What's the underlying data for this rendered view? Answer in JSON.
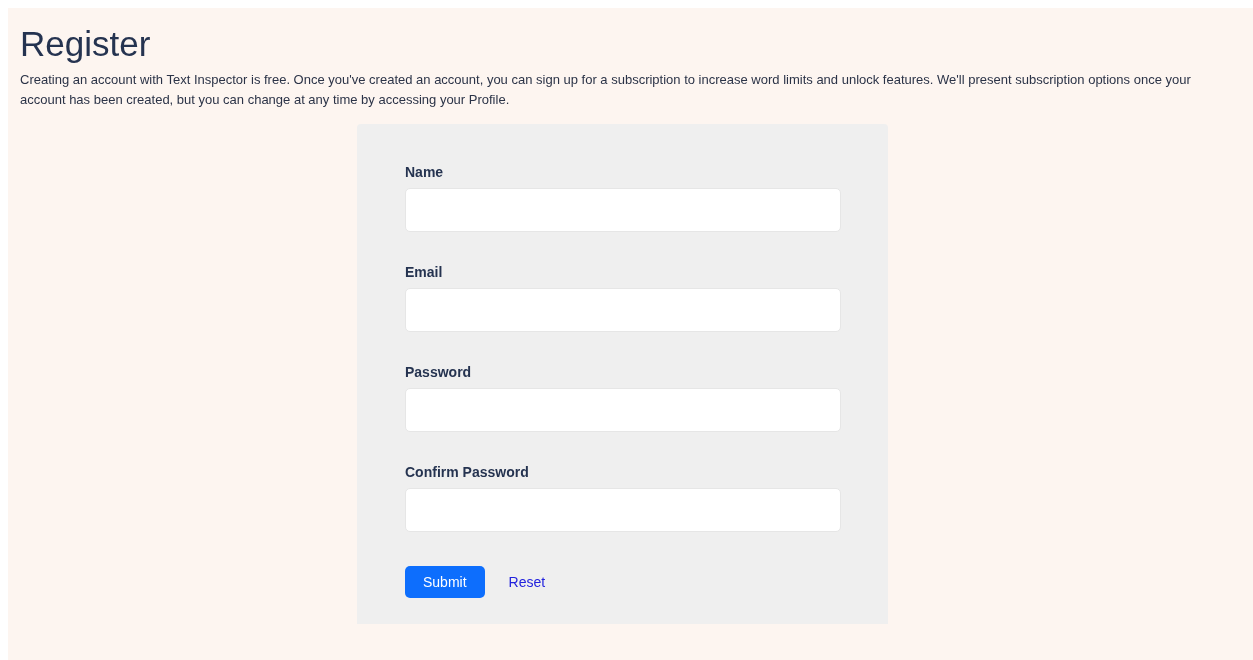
{
  "title": "Register",
  "intro": "Creating an account with Text Inspector is free. Once you've created an account, you can sign up for a subscription to increase word limits and unlock features. We'll present subscription options once your account has been created, but you can change at any time by accessing your Profile.",
  "fields": [
    {
      "label": "Name"
    },
    {
      "label": "Email"
    },
    {
      "label": "Password"
    },
    {
      "label": "Confirm Password"
    }
  ],
  "buttons": {
    "submit": "Submit",
    "reset": "Reset"
  }
}
